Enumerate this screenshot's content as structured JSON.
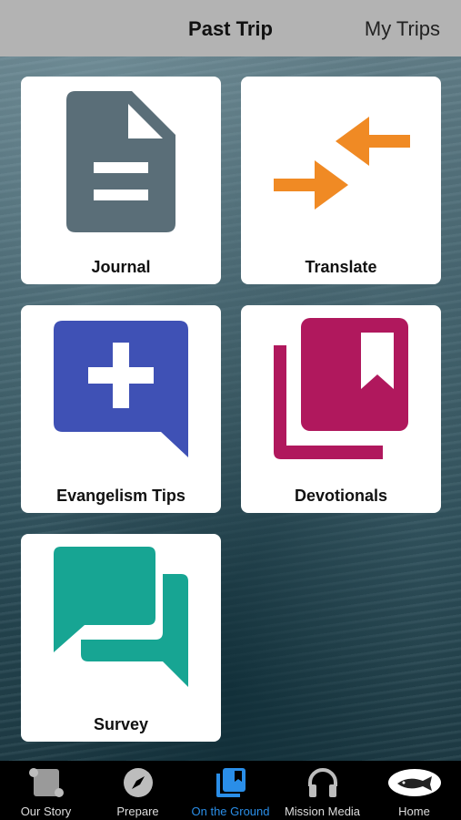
{
  "header": {
    "title": "Past Trip",
    "my_trips_label": "My Trips"
  },
  "tiles": [
    {
      "label": "Journal",
      "icon": "document-icon",
      "color": "#5a6e78"
    },
    {
      "label": "Translate",
      "icon": "translate-arrows-icon",
      "color": "#f08a24"
    },
    {
      "label": "Evangelism Tips",
      "icon": "chat-plus-icon",
      "color": "#3f51b5"
    },
    {
      "label": "Devotionals",
      "icon": "bookmark-books-icon",
      "color": "#b0185d"
    },
    {
      "label": "Survey",
      "icon": "chat-bubbles-icon",
      "color": "#17a593"
    }
  ],
  "tabs": [
    {
      "label": "Our Story",
      "icon": "scroll-icon"
    },
    {
      "label": "Prepare",
      "icon": "compass-icon"
    },
    {
      "label": "On the Ground",
      "icon": "books-icon",
      "active": true,
      "color": "#2a8ee8"
    },
    {
      "label": "Mission Media",
      "icon": "headphones-icon"
    },
    {
      "label": "Home",
      "icon": "fish-logo-icon"
    }
  ]
}
